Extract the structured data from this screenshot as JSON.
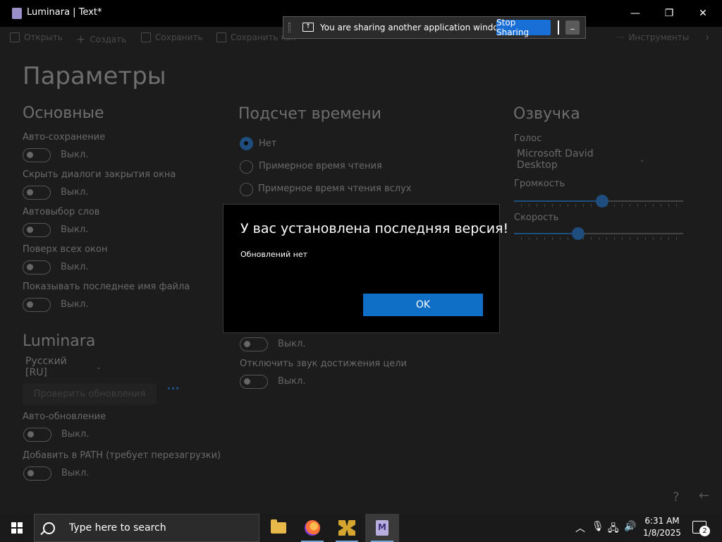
{
  "window": {
    "title": "Luminara | Text*",
    "minimize_glyph": "—",
    "maximize_glyph": "❐",
    "close_glyph": "✕"
  },
  "toolbar": {
    "open": "Открыть",
    "create": "Создать",
    "save": "Сохранить",
    "save_as": "Сохранить как",
    "more_glyph": "···",
    "tools": "Инструменты",
    "overflow_glyph": "›"
  },
  "share_bar": {
    "message": "You are sharing another application window.",
    "stop_label": "Stop Sharing",
    "minimize_glyph": "_"
  },
  "page": {
    "title": "Параметры"
  },
  "general": {
    "heading": "Основные",
    "autosave": {
      "label": "Авто-сохранение",
      "state": "Выкл."
    },
    "hide_close_dialogs": {
      "label": "Скрыть диалоги закрытия окна",
      "state": "Выкл."
    },
    "autoselect_words": {
      "label": "Автовыбор слов",
      "state": "Выкл."
    },
    "always_on_top": {
      "label": "Поверх всех окон",
      "state": "Выкл."
    },
    "show_last_filename": {
      "label": "Показывать последнее имя файла",
      "state": "Выкл."
    }
  },
  "luminara": {
    "heading": "Luminara",
    "language": "Русский [RU]",
    "check_updates": "Проверить обновления",
    "spinner": "•••",
    "auto_update": {
      "label": "Авто-обновление",
      "state": "Выкл."
    },
    "add_to_path": {
      "label": "Добавить в PATH (требует перезагрузки)",
      "state": "Выкл."
    }
  },
  "timing": {
    "heading": "Подсчет времени",
    "options": [
      {
        "label": "Нет",
        "selected": true
      },
      {
        "label": "Примерное время чтения",
        "selected": false
      },
      {
        "label": "Примерное время чтения вслух",
        "selected": false
      }
    ],
    "hidden_toggle_state": "Выкл.",
    "mute_goal": {
      "label": "Отключить звук достижения цели",
      "state": "Выкл."
    }
  },
  "voice": {
    "heading": "Озвучка",
    "voice_label": "Голос",
    "voice_value": "Microsoft David Desktop",
    "volume_label": "Громкость",
    "volume_value": 0.52,
    "speed_label": "Скорость",
    "speed_value": 0.38
  },
  "corner": {
    "help_glyph": "?",
    "back_glyph": "←"
  },
  "dialog": {
    "title": "У вас установлена последняя версия!",
    "message": "Обновлений нет",
    "ok": "OK"
  },
  "taskbar": {
    "search_placeholder": "Type here to search",
    "time": "6:31 AM",
    "date": "1/8/2025",
    "chevron_glyph": "︿",
    "mic_glyph": "🎙",
    "network_glyph": "🖧",
    "volume_glyph": "🔊",
    "notification_count": "2"
  },
  "colors": {
    "accent": "#0f6fc6",
    "share_button": "#1a6fd6",
    "dim_accent": "#1e4d7e"
  }
}
